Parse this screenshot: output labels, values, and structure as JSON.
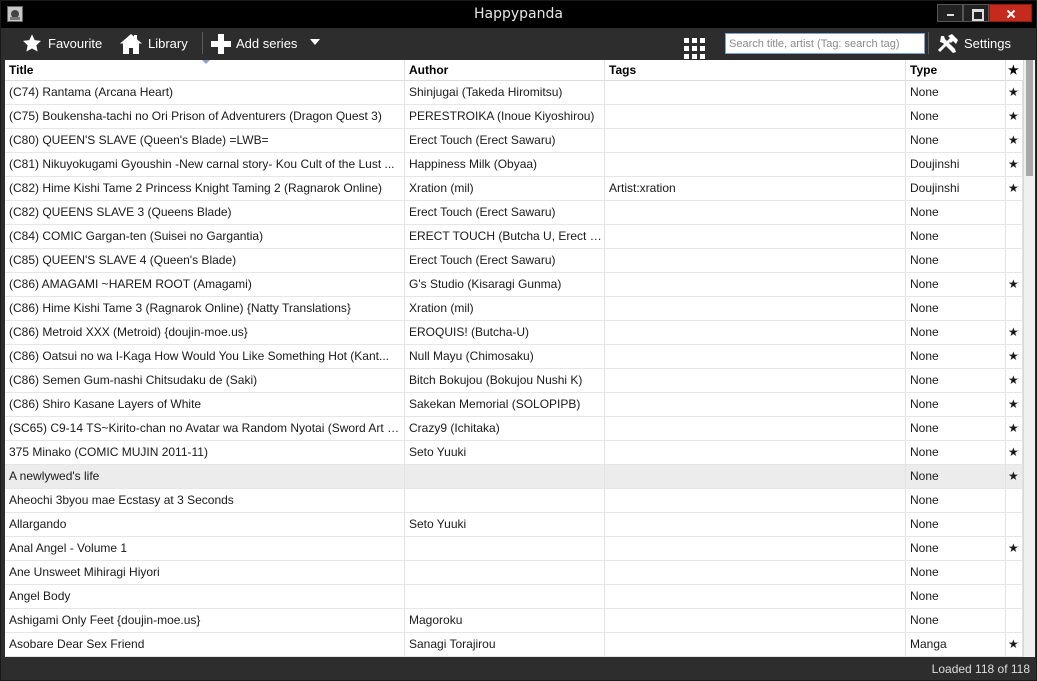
{
  "window": {
    "title": "Happypanda"
  },
  "toolbar": {
    "favourite_label": "Favourite",
    "library_label": "Library",
    "add_series_label": "Add series",
    "search_placeholder": "Search title, artist (Tag: search tag)",
    "settings_label": "Settings",
    "icons": [
      "star-icon",
      "home-icon",
      "plus-icon",
      "chevron-down-icon",
      "grid-icon",
      "tools-icon"
    ]
  },
  "table": {
    "columns": [
      "Title",
      "Author",
      "Tags",
      "Type",
      "★"
    ],
    "rows": [
      {
        "title": "(C74)  Rantama (Arcana Heart)",
        "author": "Shinjugai (Takeda Hiromitsu)",
        "tags": "",
        "type": "None",
        "fav": "★"
      },
      {
        "title": "(C75)  Boukensha-tachi no Ori   Prison of Adventurers (Dragon Quest 3)",
        "author": "PERESTROIKA (Inoue Kiyoshirou)",
        "tags": "",
        "type": "None",
        "fav": "★"
      },
      {
        "title": "(C80)  QUEEN'S SLAVE (Queen's Blade)  =LWB=",
        "author": "Erect Touch (Erect Sawaru)",
        "tags": "",
        "type": "None",
        "fav": "★"
      },
      {
        "title": "(C81)  Nikuyokugami Gyoushin -New carnal story- Kou   Cult of the Lust ...",
        "author": "Happiness Milk (Obyaa)",
        "tags": "",
        "type": "Doujinshi",
        "fav": "★"
      },
      {
        "title": "(C82)  Hime Kishi Tame 2   Princess Knight Taming 2 (Ragnarok Online)",
        "author": "Xration (mil)",
        "tags": "Artist:xration",
        "type": "Doujinshi",
        "fav": "★"
      },
      {
        "title": "(C82)  QUEENS SLAVE 3 (Queens Blade)",
        "author": "Erect Touch (Erect Sawaru)",
        "tags": "",
        "type": "None",
        "fav": ""
      },
      {
        "title": "(C84)  COMIC Gargan-ten (Suisei no Gargantia)",
        "author": "ERECT TOUCH (Butcha U, Erect Sa...",
        "tags": "",
        "type": "None",
        "fav": ""
      },
      {
        "title": "(C85)  QUEEN'S SLAVE 4 (Queen's Blade)",
        "author": "Erect Touch (Erect Sawaru)",
        "tags": "",
        "type": "None",
        "fav": ""
      },
      {
        "title": "(C86)  AMAGAMI ~HAREM ROOT (Amagami)",
        "author": "G's Studio (Kisaragi Gunma)",
        "tags": "",
        "type": "None",
        "fav": "★"
      },
      {
        "title": "(C86)  Hime Kishi Tame 3 (Ragnarok Online)  {Natty Translations}",
        "author": "Xration (mil)",
        "tags": "",
        "type": "None",
        "fav": ""
      },
      {
        "title": "(C86)  Metroid XXX (Metroid)  {doujin-moe.us}",
        "author": "EROQUIS! (Butcha-U)",
        "tags": "",
        "type": "None",
        "fav": "★"
      },
      {
        "title": "(C86)  Oatsui no wa I-Kaga   How Would You Like Something Hot (Kant...",
        "author": "Null Mayu (Chimosaku)",
        "tags": "",
        "type": "None",
        "fav": "★"
      },
      {
        "title": "(C86)  Semen Gum-nashi Chitsudaku de (Saki)",
        "author": "Bitch Bokujou (Bokujou Nushi K)",
        "tags": "",
        "type": "None",
        "fav": "★"
      },
      {
        "title": "(C86)  Shiro Kasane   Layers of White",
        "author": "Sakekan Memorial (SOLOPIPB)",
        "tags": "",
        "type": "None",
        "fav": "★"
      },
      {
        "title": "(SC65)  C9-14 TS~Kirito-chan no Avatar wa Random Nyotai (Sword Art O...",
        "author": "Crazy9 (Ichitaka)",
        "tags": "",
        "type": "None",
        "fav": "★"
      },
      {
        "title": "375   Minako (COMIC MUJIN 2011-11)",
        "author": "Seto Yuuki",
        "tags": "",
        "type": "None",
        "fav": "★"
      },
      {
        "title": "A newlywed's life",
        "author": "",
        "tags": "",
        "type": "None",
        "fav": "★"
      },
      {
        "title": "Aheochi 3byou mae   Ecstasy at 3 Seconds",
        "author": "",
        "tags": "",
        "type": "None",
        "fav": ""
      },
      {
        "title": "Allargando",
        "author": "Seto Yuuki",
        "tags": "",
        "type": "None",
        "fav": ""
      },
      {
        "title": "Anal Angel - Volume 1",
        "author": "",
        "tags": "",
        "type": "None",
        "fav": "★"
      },
      {
        "title": "Ane Unsweet Mihiragi Hiyori",
        "author": "",
        "tags": "",
        "type": "None",
        "fav": ""
      },
      {
        "title": "Angel Body",
        "author": "",
        "tags": "",
        "type": "None",
        "fav": ""
      },
      {
        "title": "Ashigami   Only Feet  {doujin-moe.us}",
        "author": "Magoroku",
        "tags": "",
        "type": "None",
        "fav": ""
      },
      {
        "title": "Asobare Dear Sex Friend",
        "author": "Sanagi Torajirou",
        "tags": "",
        "type": "Manga",
        "fav": "★"
      },
      {
        "title": "",
        "author": "",
        "tags": "",
        "type": "",
        "fav": ""
      }
    ],
    "selected_row": 16,
    "scroll_position": 0.0
  },
  "status": {
    "text": "Loaded 118 of 118"
  }
}
